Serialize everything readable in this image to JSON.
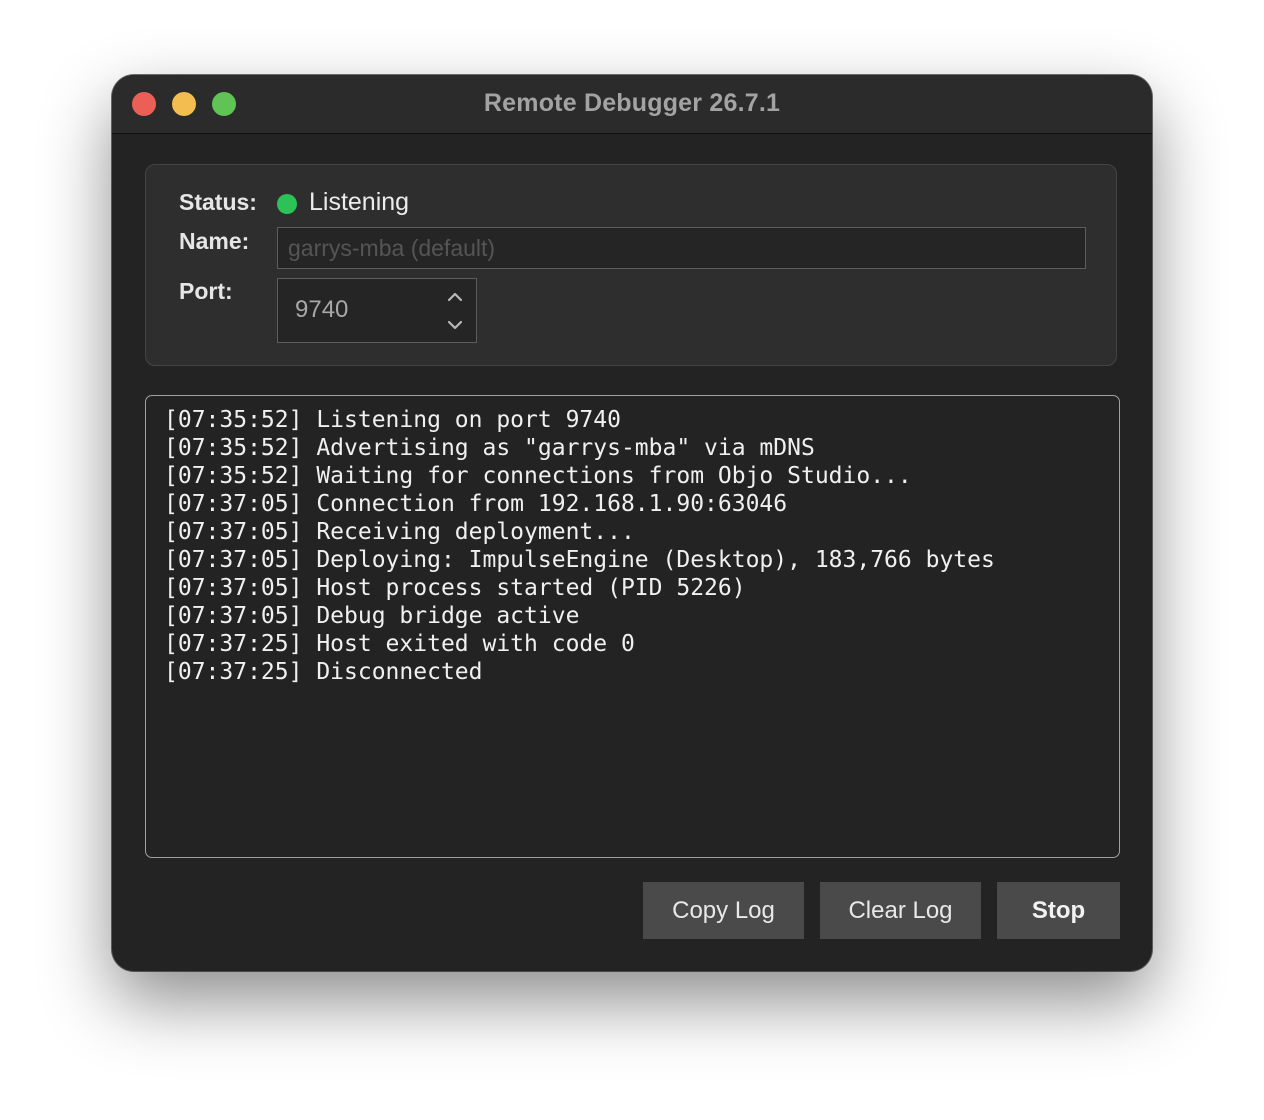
{
  "window": {
    "title": "Remote Debugger 26.7.1"
  },
  "colors": {
    "window_bg": "#232323",
    "titlebar_bg": "#2b2b2b",
    "panel_bg": "#2e2e2e",
    "status_listening": "#2cc257",
    "traffic_close": "#ec5f57",
    "traffic_minimize": "#f4bd4f",
    "traffic_maximize": "#5fc453",
    "button_bg": "#4a4a4a"
  },
  "settings": {
    "status_label": "Status:",
    "status_value": "Listening",
    "status_icon": "green-dot-icon",
    "name_label": "Name:",
    "name_value": "",
    "name_placeholder": "garrys-mba (default)",
    "port_label": "Port:",
    "port_value": "9740"
  },
  "log": {
    "lines": [
      "[07:35:52] Listening on port 9740",
      "[07:35:52] Advertising as \"garrys-mba\" via mDNS",
      "[07:35:52] Waiting for connections from Objo Studio...",
      "[07:37:05] Connection from 192.168.1.90:63046",
      "[07:37:05] Receiving deployment...",
      "[07:37:05] Deploying: ImpulseEngine (Desktop), 183,766 bytes",
      "[07:37:05] Host process started (PID 5226)",
      "[07:37:05] Debug bridge active",
      "[07:37:25] Host exited with code 0",
      "[07:37:25] Disconnected"
    ]
  },
  "buttons": {
    "copy_log": "Copy Log",
    "clear_log": "Clear Log",
    "stop": "Stop"
  }
}
